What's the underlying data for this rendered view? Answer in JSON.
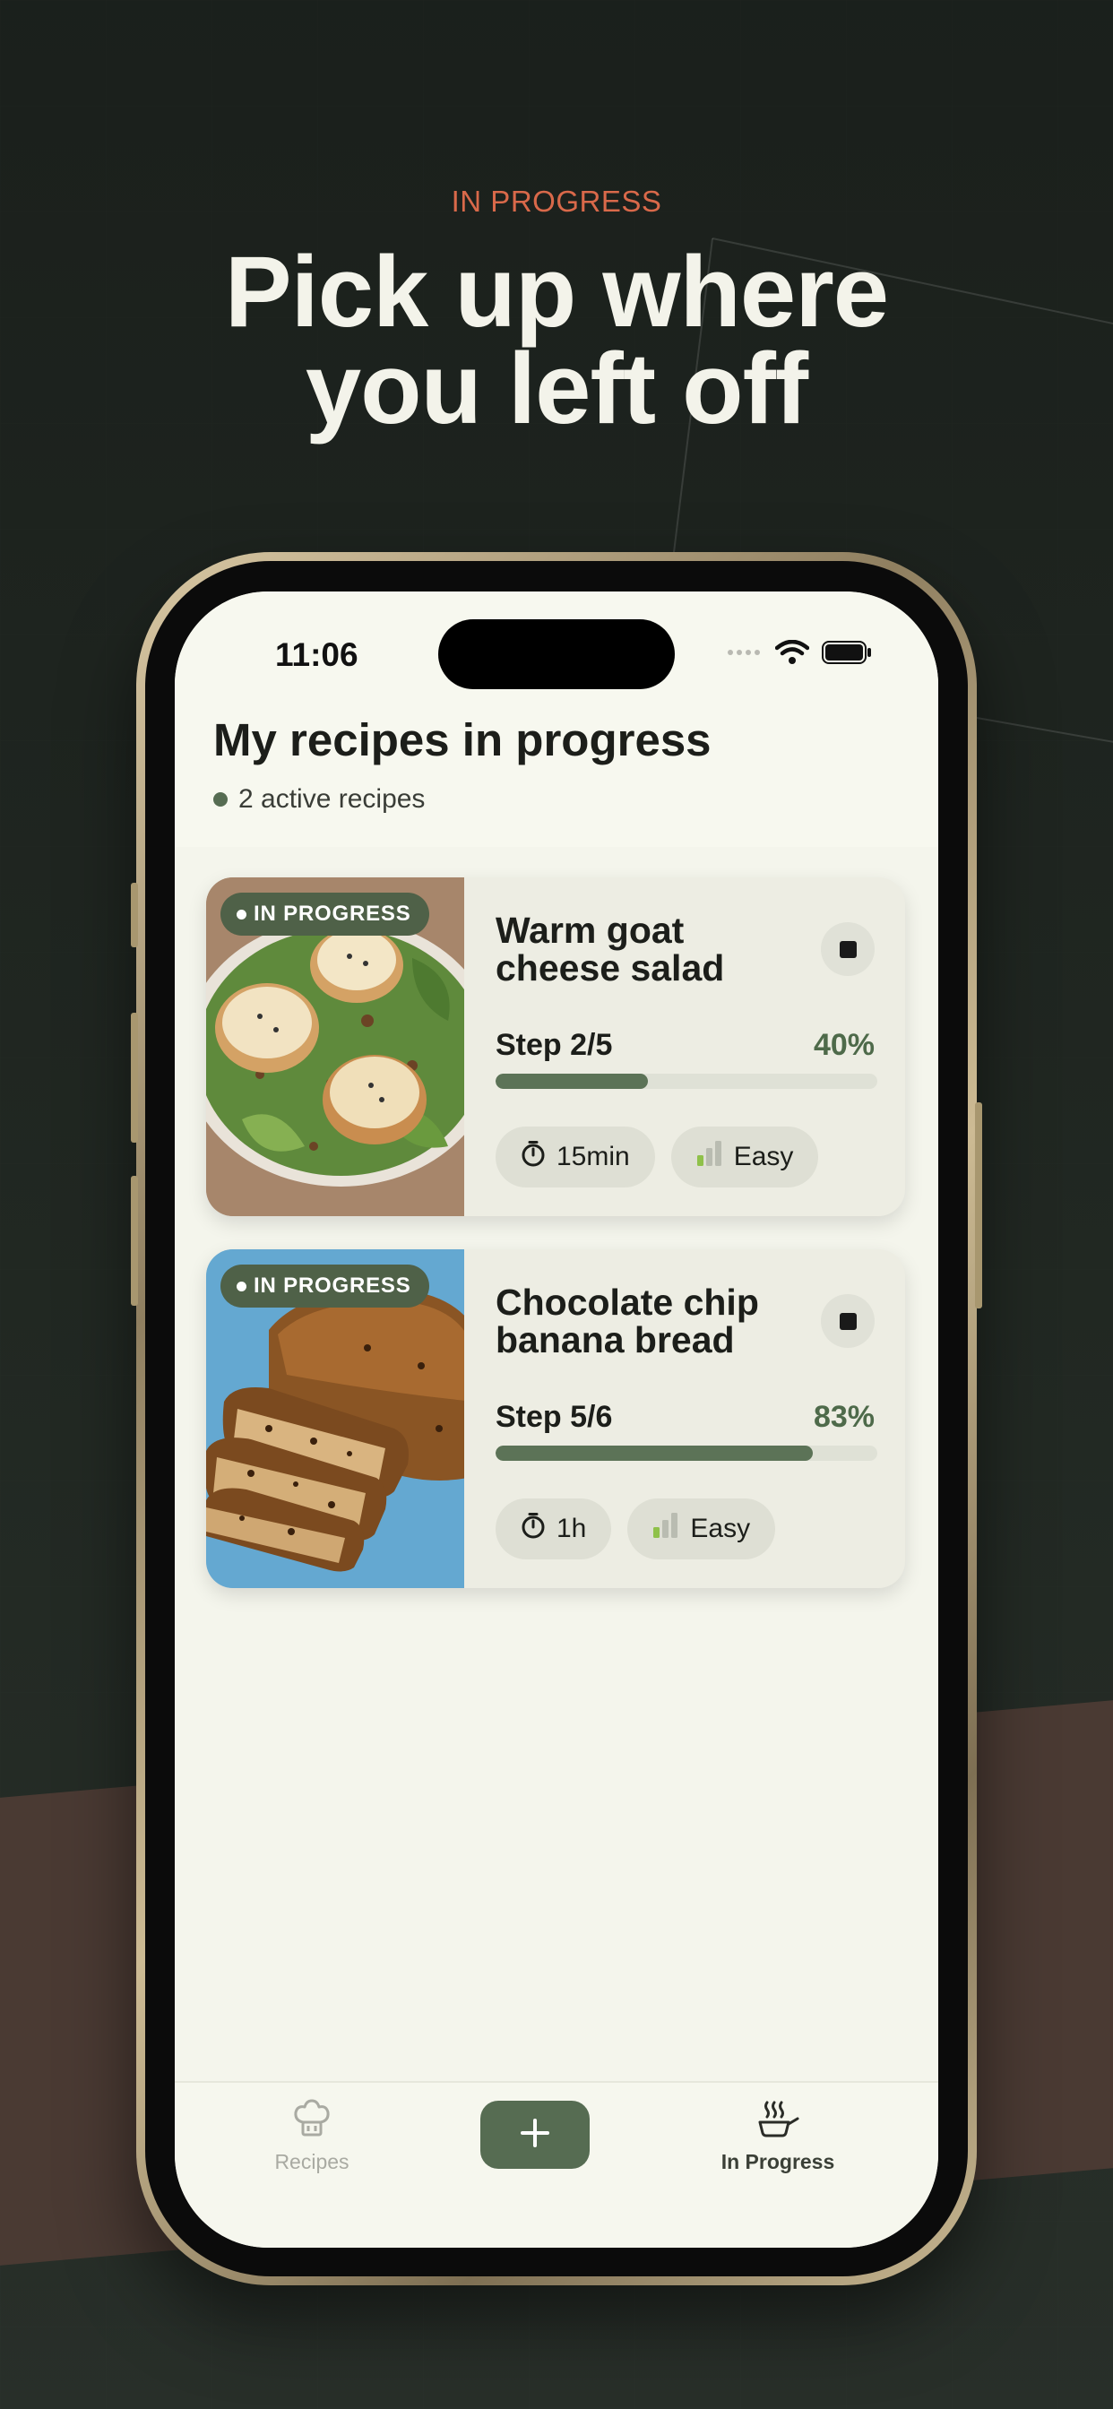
{
  "hero": {
    "eyebrow": "IN PROGRESS",
    "headline_line1": "Pick up where",
    "headline_line2": "you left off"
  },
  "status_bar": {
    "time": "11:06",
    "icons": [
      "signal-icon",
      "wifi-icon",
      "battery-icon"
    ]
  },
  "screen": {
    "title": "My recipes in progress",
    "active_count_text": "2 active recipes"
  },
  "recipes": [
    {
      "badge": "IN PROGRESS",
      "title_line1": "Warm goat",
      "title_line2": "cheese salad",
      "step": "Step 2/5",
      "percent_text": "40%",
      "progress": 0.4,
      "time": "15min",
      "difficulty": "Easy",
      "image": "goat-cheese-salad-photo"
    },
    {
      "badge": "IN PROGRESS",
      "title_line1": "Chocolate chip",
      "title_line2": "banana bread",
      "step": "Step 5/6",
      "percent_text": "83%",
      "progress": 0.83,
      "time": "1h",
      "difficulty": "Easy",
      "image": "banana-bread-photo"
    }
  ],
  "tabbar": {
    "recipes_label": "Recipes",
    "add_icon": "plus-icon",
    "in_progress_label": "In Progress",
    "active_tab": "In Progress"
  },
  "colors": {
    "accent": "#566c52",
    "eyebrow": "#d9694a",
    "background": "#1d231f",
    "screen_bg": "#f4f5ec"
  }
}
